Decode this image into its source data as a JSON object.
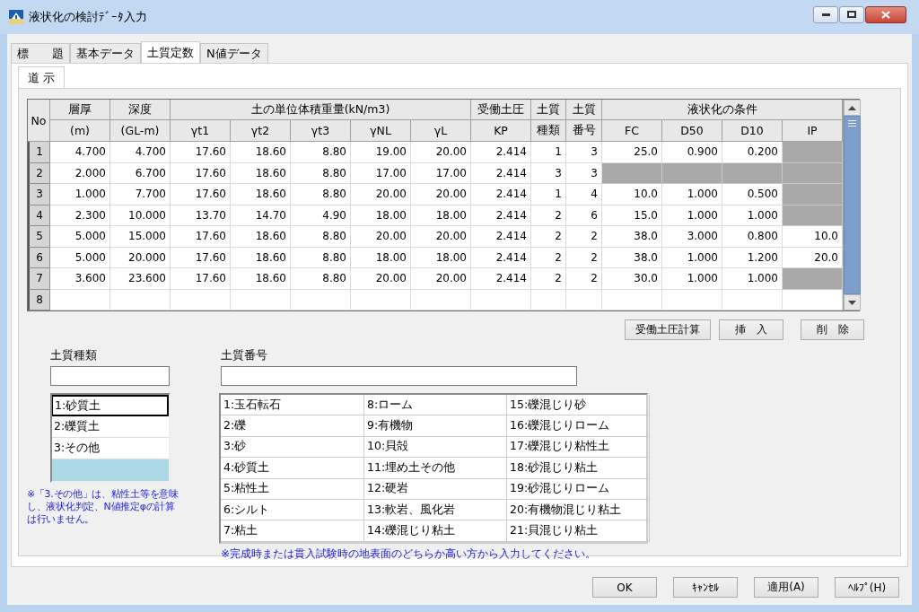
{
  "window": {
    "title": "液状化の検討ﾃﾞｰﾀ入力"
  },
  "tabs": [
    {
      "label": "標　　題",
      "selected": false
    },
    {
      "label": "基本データ",
      "selected": false
    },
    {
      "label": "土質定数",
      "selected": true
    },
    {
      "label": "N値データ",
      "selected": false
    }
  ],
  "subtabs": [
    {
      "label": "道 示",
      "selected": true
    }
  ],
  "table": {
    "no_header": "No",
    "group_headers": [
      "層厚",
      "深度",
      "土の単位体積重量(kN/m3)",
      "受働土圧",
      "土質",
      "土質",
      "液状化の条件"
    ],
    "columns": [
      "(m)",
      "(GL-m)",
      "γt1",
      "γt2",
      "γt3",
      "γNL",
      "γL",
      "KP",
      "種類",
      "番号",
      "FC",
      "D50",
      "D10",
      "IP"
    ],
    "rows": [
      {
        "no": "1",
        "values": [
          "4.700",
          "4.700",
          "17.60",
          "18.60",
          "8.80",
          "19.00",
          "20.00",
          "2.414",
          "1",
          "3"
        ],
        "conditions": [
          {
            "value": "25.0",
            "disabled": false
          },
          {
            "value": "0.900",
            "disabled": false
          },
          {
            "value": "0.200",
            "disabled": false
          },
          {
            "disabled": true
          }
        ]
      },
      {
        "no": "2",
        "values": [
          "2.000",
          "6.700",
          "17.60",
          "18.60",
          "8.80",
          "17.00",
          "17.00",
          "2.414",
          "3",
          "3"
        ],
        "conditions": [
          {
            "disabled": true
          },
          {
            "disabled": true
          },
          {
            "disabled": true
          },
          {
            "disabled": true
          }
        ]
      },
      {
        "no": "3",
        "values": [
          "1.000",
          "7.700",
          "17.60",
          "18.60",
          "8.80",
          "20.00",
          "20.00",
          "2.414",
          "1",
          "4"
        ],
        "conditions": [
          {
            "value": "10.0",
            "disabled": false
          },
          {
            "value": "1.000",
            "disabled": false
          },
          {
            "value": "0.500",
            "disabled": false
          },
          {
            "disabled": true
          }
        ]
      },
      {
        "no": "4",
        "values": [
          "2.300",
          "10.000",
          "13.70",
          "14.70",
          "4.90",
          "18.00",
          "18.00",
          "2.414",
          "2",
          "6"
        ],
        "conditions": [
          {
            "value": "15.0",
            "disabled": false
          },
          {
            "value": "1.000",
            "disabled": false
          },
          {
            "value": "1.000",
            "disabled": false
          },
          {
            "disabled": true
          }
        ]
      },
      {
        "no": "5",
        "values": [
          "5.000",
          "15.000",
          "17.60",
          "18.60",
          "8.80",
          "20.00",
          "20.00",
          "2.414",
          "2",
          "2"
        ],
        "conditions": [
          {
            "value": "38.0",
            "disabled": false
          },
          {
            "value": "3.000",
            "disabled": false
          },
          {
            "value": "0.800",
            "disabled": false
          },
          {
            "value": "10.0",
            "disabled": false
          }
        ]
      },
      {
        "no": "6",
        "values": [
          "5.000",
          "20.000",
          "17.60",
          "18.60",
          "8.80",
          "18.00",
          "18.00",
          "2.414",
          "2",
          "2"
        ],
        "conditions": [
          {
            "value": "38.0",
            "disabled": false
          },
          {
            "value": "1.000",
            "disabled": false
          },
          {
            "value": "1.200",
            "disabled": false
          },
          {
            "value": "20.0",
            "disabled": false
          }
        ]
      },
      {
        "no": "7",
        "values": [
          "3.600",
          "23.600",
          "17.60",
          "18.60",
          "8.80",
          "20.00",
          "20.00",
          "2.414",
          "2",
          "2"
        ],
        "conditions": [
          {
            "value": "30.0",
            "disabled": false
          },
          {
            "value": "1.000",
            "disabled": false
          },
          {
            "value": "1.000",
            "disabled": false
          },
          {
            "disabled": true
          }
        ]
      },
      {
        "no": "8"
      }
    ]
  },
  "actions": [
    "受働土圧計算",
    "挿　入",
    "削　除"
  ],
  "soil_type": {
    "label": "土質種類",
    "items": [
      {
        "label": "1:砂質土",
        "focused": true
      },
      {
        "label": "2:礫質土",
        "focused": false
      },
      {
        "label": "3:その他",
        "focused": false
      }
    ],
    "note": "※「3.その他」は、粘性土等を意味し、液状化判定、N値推定φの計算は行いません。"
  },
  "soil_number": {
    "label": "土質番号",
    "items": [
      "1:玉石転石",
      "2:礫",
      "3:砂",
      "4:砂質土",
      "5:粘性土",
      "6:シルト",
      "7:粘土",
      "8:ローム",
      "9:有機物",
      "10:貝殻",
      "11:埋め土その他",
      "12:硬岩",
      "13:軟岩、風化岩",
      "14:礫混じり粘土",
      "15:礫混じり砂",
      "16:礫混じりローム",
      "17:礫混じり粘性土",
      "18:砂混じり粘土",
      "19:砂混じりローム",
      "20:有機物混じり粘土",
      "21:貝混じり粘土"
    ],
    "note": "※完成時または貫入試験時の地表面のどちらか高い方から入力してください。"
  },
  "buttons": [
    "OK",
    "ｷｬﾝｾﾙ",
    "適用(A)",
    "ﾍﾙﾌﾟ(H)"
  ]
}
